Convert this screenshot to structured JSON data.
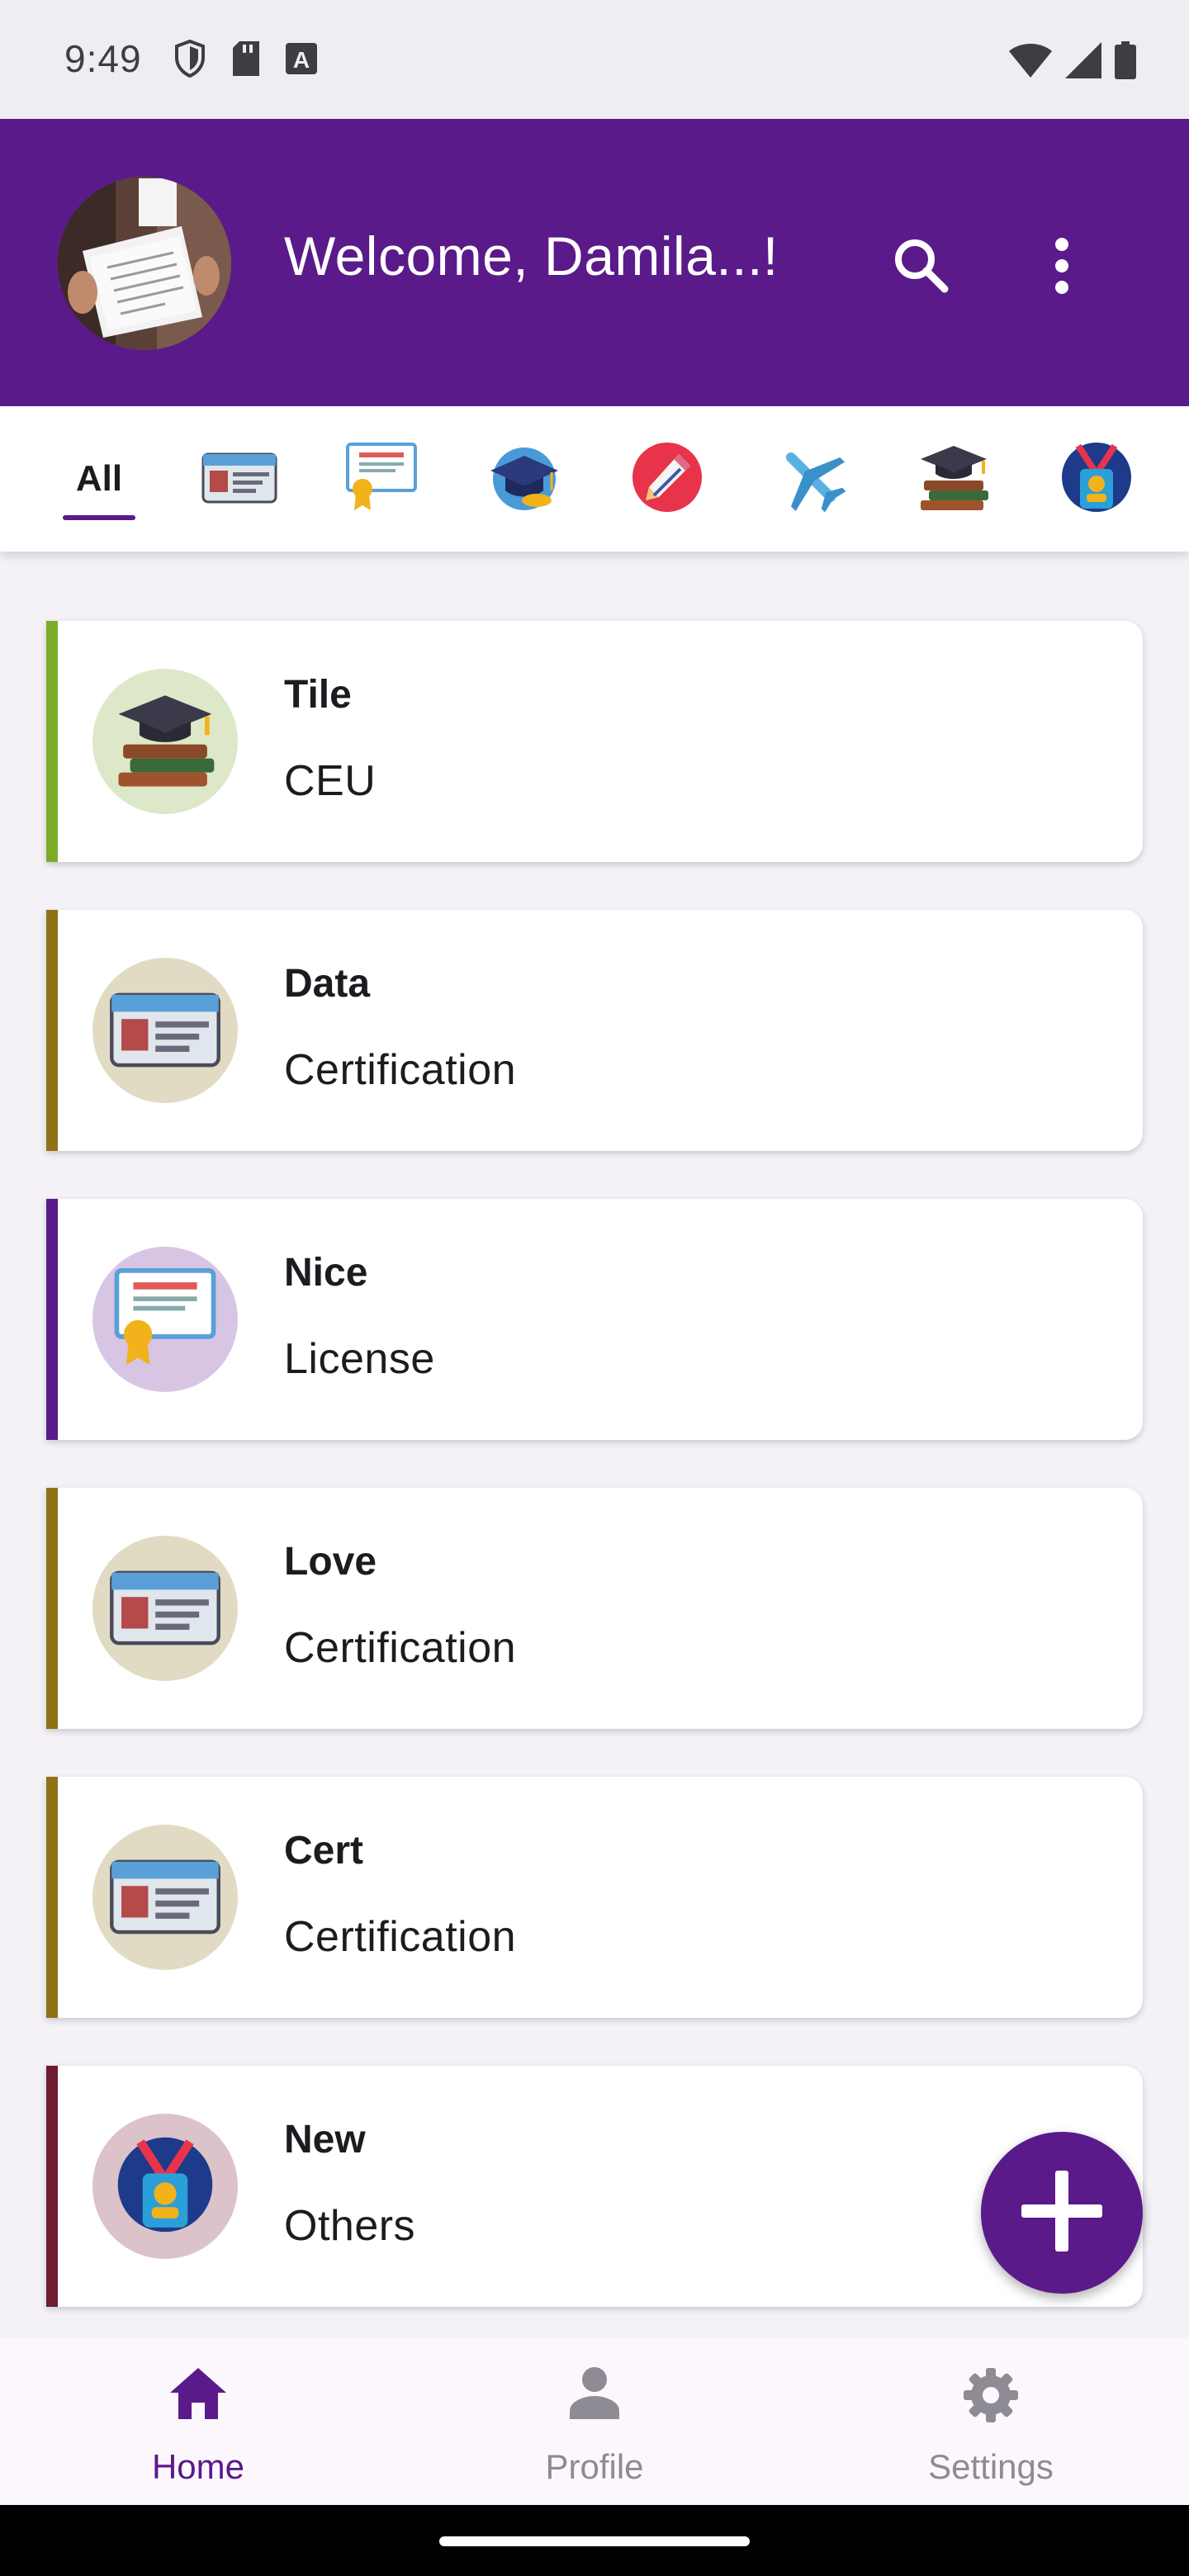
{
  "status_bar": {
    "time": "9:49",
    "icons": [
      "shield-icon",
      "sd-card-icon",
      "keyboard-a-icon",
      "wifi-icon",
      "signal-icon",
      "battery-icon"
    ]
  },
  "app_bar": {
    "title": "Welcome, Damila...!",
    "background_color": "#5a1a8a",
    "icons": [
      "search-icon",
      "more-vert-icon"
    ]
  },
  "tabs": {
    "selected": "All",
    "items": [
      {
        "label": "All"
      },
      {
        "icon": "id-card-icon"
      },
      {
        "icon": "certificate-icon"
      },
      {
        "icon": "graduation-cap-icon"
      },
      {
        "icon": "pencil-icon"
      },
      {
        "icon": "airplane-icon"
      },
      {
        "icon": "books-icon"
      },
      {
        "icon": "badge-icon"
      }
    ]
  },
  "cards": [
    {
      "title": "Tile",
      "subtitle": "CEU",
      "icon": "books-icon",
      "accent": "#7cab2a",
      "circle": "#dde8c8"
    },
    {
      "title": "Data",
      "subtitle": "Certification",
      "icon": "id-card-icon",
      "accent": "#8e7215",
      "circle": "#e1dbc4"
    },
    {
      "title": "Nice",
      "subtitle": "License",
      "icon": "certificate-icon",
      "accent": "#5a1a8a",
      "circle": "#d8c5e4"
    },
    {
      "title": "Love",
      "subtitle": "Certification",
      "icon": "id-card-icon",
      "accent": "#8e7215",
      "circle": "#e1dbc4"
    },
    {
      "title": "Cert",
      "subtitle": "Certification",
      "icon": "id-card-icon",
      "accent": "#8e7215",
      "circle": "#e1dbc4"
    },
    {
      "title": "New",
      "subtitle": "Others",
      "icon": "badge-icon",
      "accent": "#6e1c32",
      "circle": "#dcc3c9"
    }
  ],
  "fab": {
    "icon": "plus-icon"
  },
  "bottom_nav": {
    "items": [
      {
        "label": "Home",
        "icon": "home-icon",
        "active": true
      },
      {
        "label": "Profile",
        "icon": "person-icon",
        "active": false
      },
      {
        "label": "Settings",
        "icon": "gear-icon",
        "active": false
      }
    ]
  }
}
